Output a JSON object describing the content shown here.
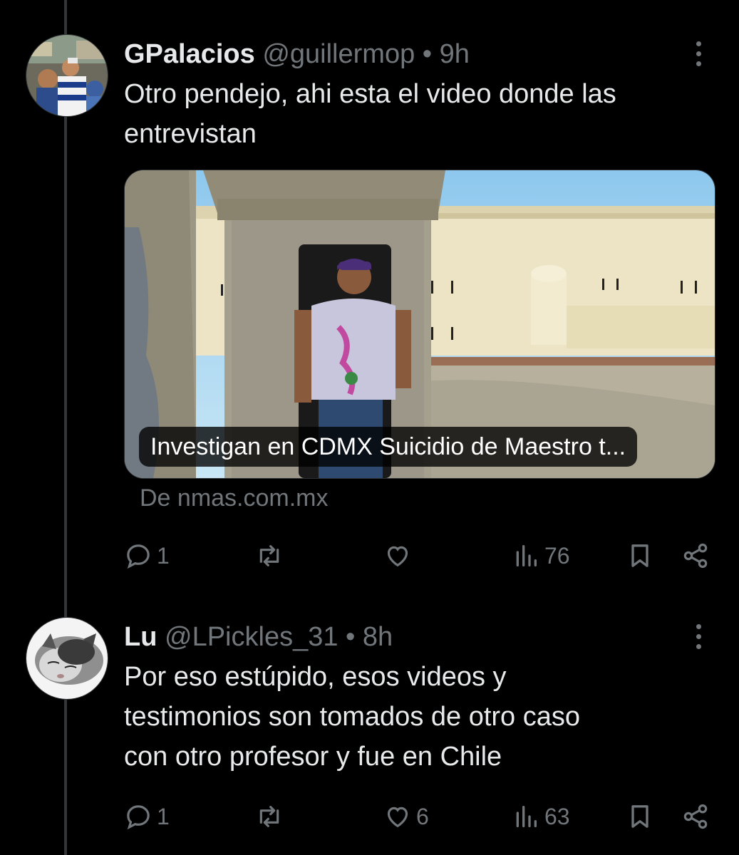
{
  "tweets": [
    {
      "name": "GPalacios",
      "handle": "@guillermop",
      "separator": "•",
      "time": "9h",
      "text": "Otro pendejo, ahi esta el video donde las\nentrevistan",
      "card": {
        "caption": "Investigan en CDMX Suicidio de Maestro t...",
        "source": "De nmas.com.mx"
      },
      "actions": {
        "replies": "1",
        "reposts": "",
        "likes": "",
        "views": "76"
      }
    },
    {
      "name": "Lu",
      "handle": "@LPickles_31",
      "separator": "•",
      "time": "8h",
      "text": "Por eso estúpido, esos videos y\ntestimonios son tomados de otro caso\ncon otro profesor y fue en Chile",
      "actions": {
        "replies": "1",
        "reposts": "",
        "likes": "6",
        "views": "63"
      }
    }
  ],
  "icons": {
    "reply": "reply-icon",
    "repost": "repost-icon",
    "like": "like-icon",
    "views": "views-icon",
    "bookmark": "bookmark-icon",
    "share": "share-icon",
    "more": "more-icon"
  },
  "colors": {
    "background": "#000000",
    "text": "#e7e9ea",
    "muted": "#71767b",
    "thread_line": "#333639"
  }
}
